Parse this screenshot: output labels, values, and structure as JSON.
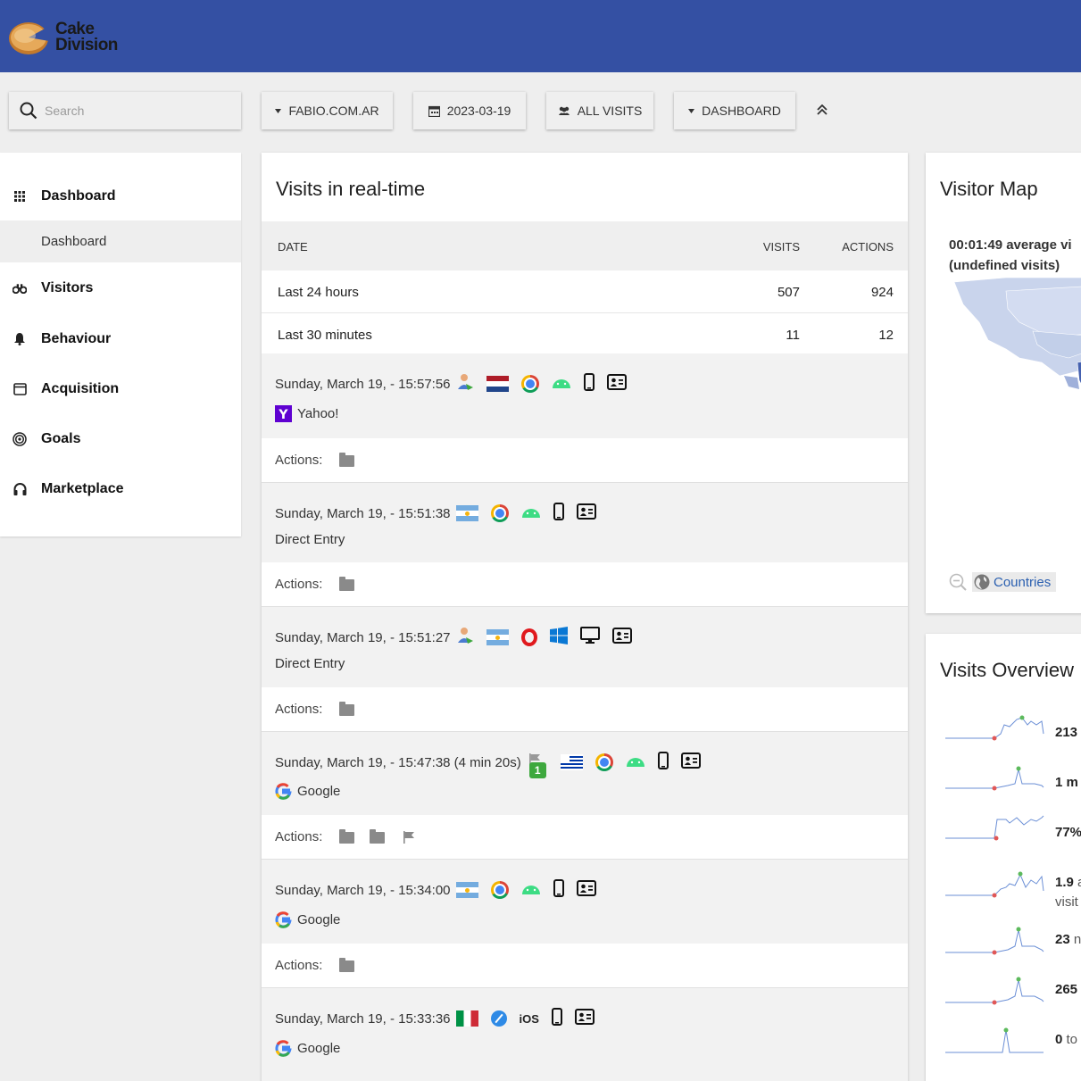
{
  "header": {
    "logo_text_1": "Cake",
    "logo_text_2": "Division"
  },
  "toolbar": {
    "search_placeholder": "Search",
    "site": "FABIO.COM.AR",
    "date": "2023-03-19",
    "segment": "ALL VISITS",
    "dashboard": "DASHBOARD"
  },
  "sidebar": {
    "dashboard": "Dashboard",
    "dashboard_sub": "Dashboard",
    "visitors": "Visitors",
    "behaviour": "Behaviour",
    "acquisition": "Acquisition",
    "goals": "Goals",
    "marketplace": "Marketplace"
  },
  "realtime": {
    "title": "Visits in real-time",
    "columns": {
      "date": "DATE",
      "visits": "VISITS",
      "actions": "ACTIONS"
    },
    "rows": [
      {
        "label": "Last 24 hours",
        "visits": "507",
        "actions": "924"
      },
      {
        "label": "Last 30 minutes",
        "visits": "11",
        "actions": "12"
      }
    ],
    "actions_label": "Actions:",
    "visits": [
      {
        "datetime": "Sunday, March 19, - 15:57:56",
        "referrer": "Yahoo!"
      },
      {
        "datetime": "Sunday, March 19, - 15:51:38",
        "referrer": "Direct Entry"
      },
      {
        "datetime": "Sunday, March 19, - 15:51:27",
        "referrer": "Direct Entry"
      },
      {
        "datetime": "Sunday, March 19, - 15:47:38 (4 min 20s)",
        "goal_badge": "1",
        "referrer": "Google"
      },
      {
        "datetime": "Sunday, March 19, - 15:34:00",
        "referrer": "Google"
      },
      {
        "datetime": "Sunday, March 19, - 15:33:36",
        "os_label": "iOS",
        "referrer": "Google"
      }
    ]
  },
  "map": {
    "title": "Visitor Map",
    "summary_line1": "00:01:49 average vi",
    "summary_line2": "(undefined visits)",
    "countries": "Countries"
  },
  "overview": {
    "title": "Visits Overview",
    "rows": [
      {
        "value": "213",
        "rest": ""
      },
      {
        "value": "1 m",
        "rest": ""
      },
      {
        "value": "77%",
        "rest": ""
      },
      {
        "value": "1.9",
        "rest": " a",
        "sub": "visit"
      },
      {
        "value": "23",
        "rest": " n"
      },
      {
        "value": "265",
        "rest": ""
      },
      {
        "value": "0",
        "rest": " to"
      }
    ]
  }
}
